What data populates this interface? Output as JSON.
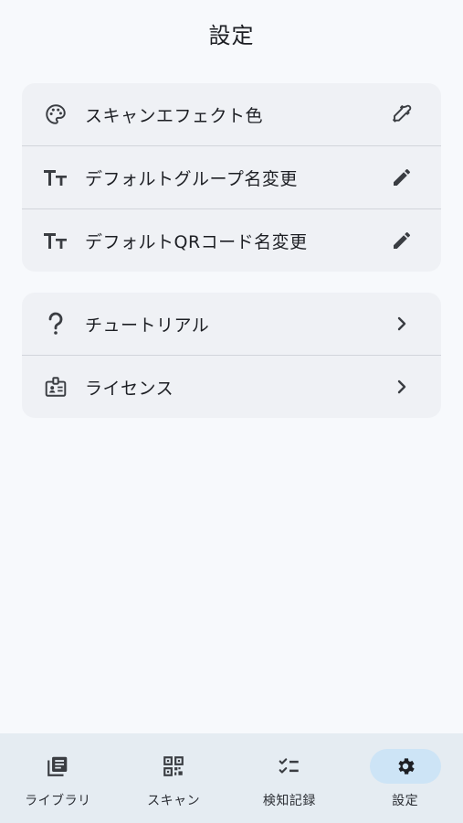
{
  "header": {
    "title": "設定"
  },
  "settings_group_1": [
    {
      "label": "スキャンエフェクト色",
      "lead_icon": "palette-icon",
      "trail_icon": "eyedropper-icon"
    },
    {
      "label": "デフォルトグループ名変更",
      "lead_icon": "text-size-icon",
      "trail_icon": "pencil-icon"
    },
    {
      "label": "デフォルトQRコード名変更",
      "lead_icon": "text-size-icon",
      "trail_icon": "pencil-icon"
    }
  ],
  "settings_group_2": [
    {
      "label": "チュートリアル",
      "lead_icon": "question-mark-icon",
      "trail_icon": "chevron-right-icon"
    },
    {
      "label": "ライセンス",
      "lead_icon": "license-badge-icon",
      "trail_icon": "chevron-right-icon"
    }
  ],
  "bottom_nav": {
    "items": [
      {
        "label": "ライブラリ",
        "icon": "library-icon"
      },
      {
        "label": "スキャン",
        "icon": "qr-scan-icon"
      },
      {
        "label": "検知記録",
        "icon": "checklist-icon"
      },
      {
        "label": "設定",
        "icon": "gear-icon"
      }
    ],
    "active_index": 3
  },
  "colors": {
    "background": "#f7f9fc",
    "card": "#eff1f5",
    "nav_background": "#e5ecf2",
    "active_pill": "#cde4f6",
    "icon": "#3a3d42"
  }
}
